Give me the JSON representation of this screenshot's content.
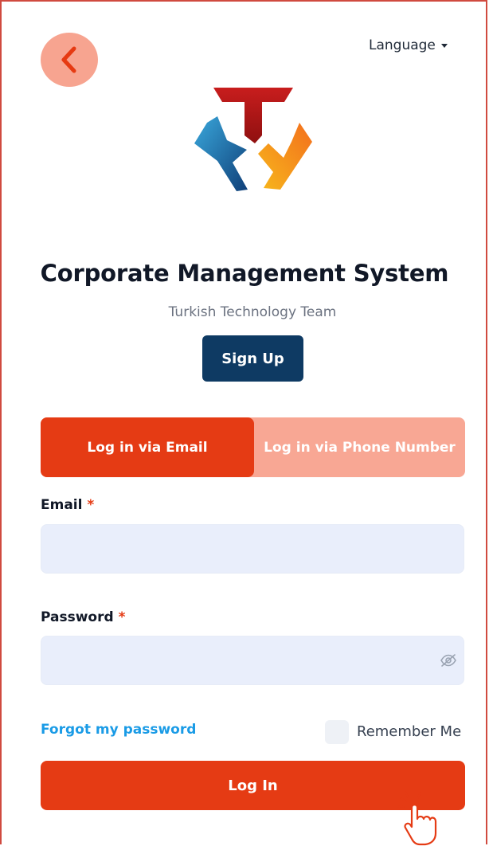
{
  "header": {
    "back_icon": "chevron-left-icon",
    "language_label": "Language"
  },
  "brand": {
    "title": "Corporate Management System",
    "subtitle": "Turkish Technology Team",
    "signup_label": "Sign Up"
  },
  "login_tabs": {
    "email_label": "Log in via Email",
    "phone_label": "Log in via Phone Number",
    "active": "email"
  },
  "form": {
    "email_label": "Email",
    "email_value": "",
    "password_label": "Password",
    "password_value": "",
    "required_mark": "*",
    "forgot_label": "Forgot my password",
    "remember_label": "Remember Me",
    "remember_checked": false,
    "submit_label": "Log In"
  },
  "colors": {
    "accent": "#e53b14",
    "accent_light": "#f8a794",
    "navy": "#0e3a63",
    "link": "#1a9be6",
    "input_bg": "#e9eefb"
  }
}
